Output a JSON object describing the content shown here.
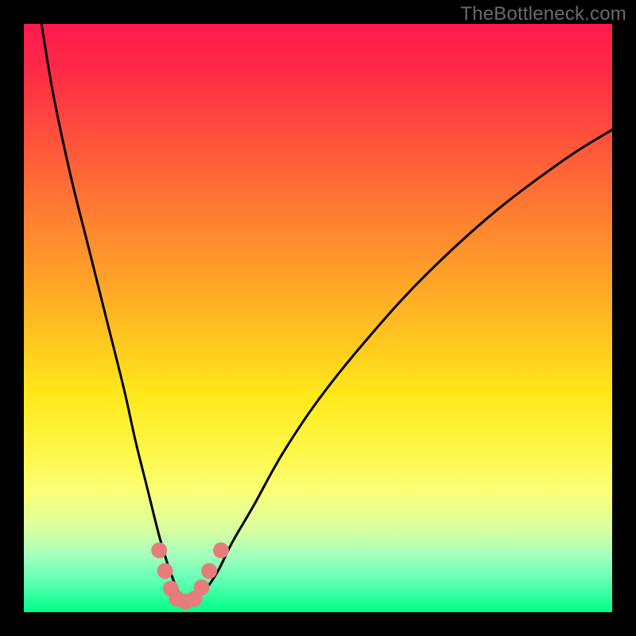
{
  "watermark": "TheBottleneck.com",
  "chart_data": {
    "type": "line",
    "title": "",
    "xlabel": "",
    "ylabel": "",
    "xlim": [
      0,
      100
    ],
    "ylim": [
      0,
      100
    ],
    "grid": false,
    "legend": false,
    "annotations": [],
    "series": [
      {
        "name": "bottleneck-curve",
        "x": [
          3,
          5,
          8,
          11,
          14,
          17,
          19,
          21,
          23,
          24.5,
          26,
          27,
          28,
          29.5,
          31,
          33,
          35.5,
          39,
          44,
          50,
          58,
          68,
          80,
          92,
          100
        ],
        "values": [
          100,
          88,
          74,
          62,
          50,
          38,
          29,
          21,
          13,
          8,
          4,
          2,
          2,
          2.5,
          4,
          7,
          12,
          18,
          27,
          36,
          46,
          57,
          68,
          77,
          82
        ]
      }
    ],
    "markers": {
      "name": "highlight-dots",
      "color": "#e77c7c",
      "points": [
        {
          "x": 23.0,
          "y": 10.5
        },
        {
          "x": 24.0,
          "y": 7.0
        },
        {
          "x": 25.0,
          "y": 4.0
        },
        {
          "x": 26.0,
          "y": 2.3
        },
        {
          "x": 27.5,
          "y": 1.8
        },
        {
          "x": 29.0,
          "y": 2.3
        },
        {
          "x": 30.2,
          "y": 4.2
        },
        {
          "x": 31.5,
          "y": 7.0
        },
        {
          "x": 33.5,
          "y": 10.5
        }
      ]
    },
    "background_gradient": {
      "top": "#ff1a4d",
      "mid": "#ffe81a",
      "bottom": "#00ff88"
    }
  }
}
